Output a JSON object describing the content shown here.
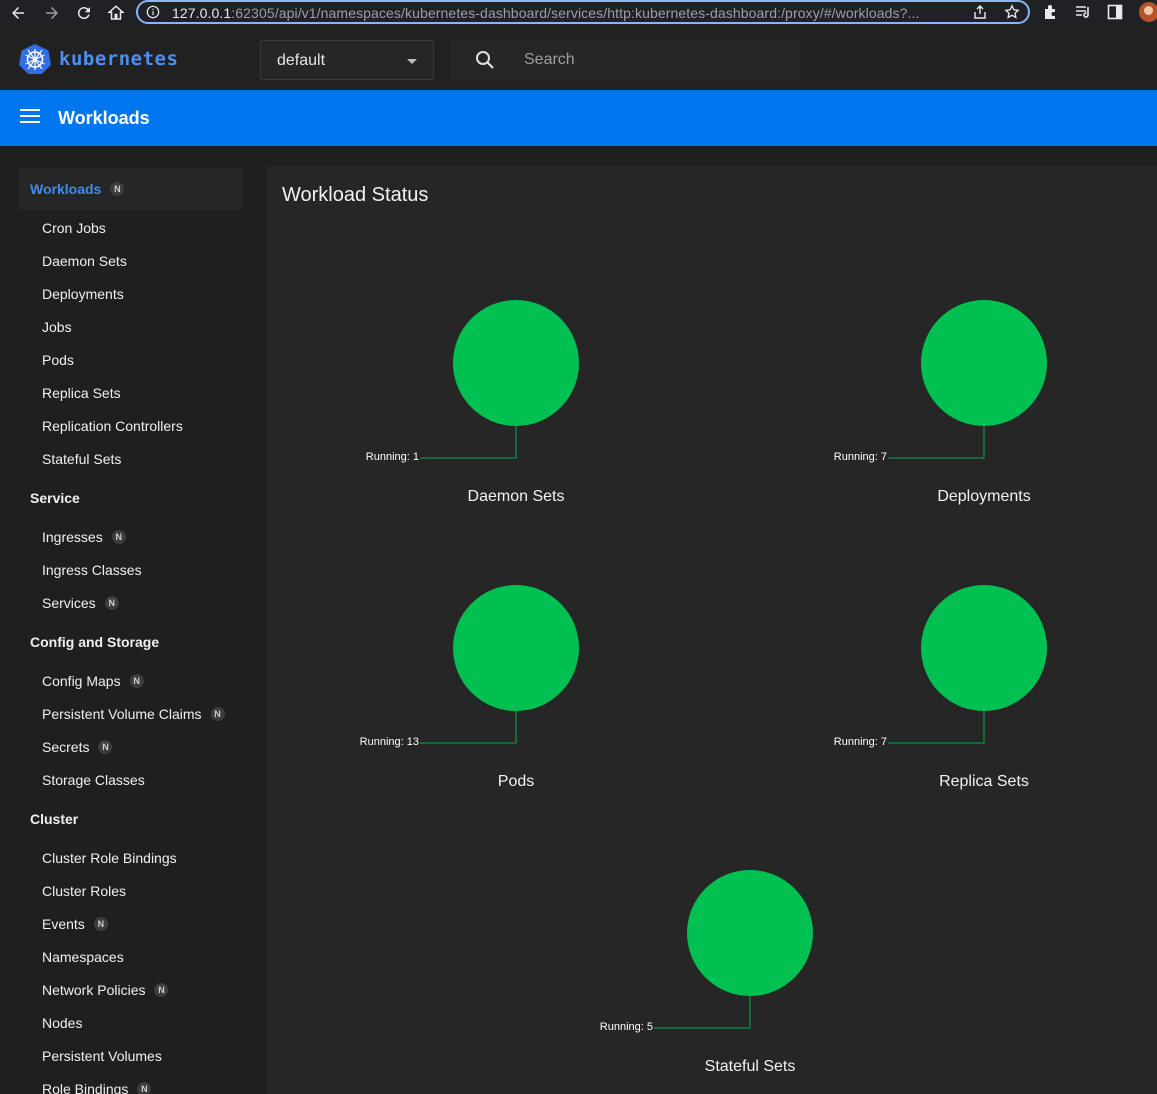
{
  "browser": {
    "url_host": "127.0.0.1",
    "url_rest": ":62305/api/v1/namespaces/kubernetes-dashboard/services/http:kubernetes-dashboard:/proxy/#/workloads?..."
  },
  "header": {
    "brand": "kubernetes",
    "namespace": "default",
    "search_placeholder": "Search",
    "page_title": "Workloads"
  },
  "sidebar": {
    "sections": [
      {
        "label": "Workloads",
        "badge": "N",
        "active": true,
        "items": [
          {
            "label": "Cron Jobs"
          },
          {
            "label": "Daemon Sets"
          },
          {
            "label": "Deployments"
          },
          {
            "label": "Jobs"
          },
          {
            "label": "Pods"
          },
          {
            "label": "Replica Sets"
          },
          {
            "label": "Replication Controllers"
          },
          {
            "label": "Stateful Sets"
          }
        ]
      },
      {
        "label": "Service",
        "items": [
          {
            "label": "Ingresses",
            "badge": "N"
          },
          {
            "label": "Ingress Classes"
          },
          {
            "label": "Services",
            "badge": "N"
          }
        ]
      },
      {
        "label": "Config and Storage",
        "items": [
          {
            "label": "Config Maps",
            "badge": "N"
          },
          {
            "label": "Persistent Volume Claims",
            "badge": "N"
          },
          {
            "label": "Secrets",
            "badge": "N"
          },
          {
            "label": "Storage Classes"
          }
        ]
      },
      {
        "label": "Cluster",
        "items": [
          {
            "label": "Cluster Role Bindings"
          },
          {
            "label": "Cluster Roles"
          },
          {
            "label": "Events",
            "badge": "N"
          },
          {
            "label": "Namespaces"
          },
          {
            "label": "Network Policies",
            "badge": "N"
          },
          {
            "label": "Nodes"
          },
          {
            "label": "Persistent Volumes"
          },
          {
            "label": "Role Bindings",
            "badge": "N"
          }
        ]
      }
    ]
  },
  "main": {
    "card_title": "Workload Status",
    "running_color": "#00c052",
    "charts": [
      {
        "name": "Daemon Sets",
        "running_label": "Running: 1",
        "running": 1
      },
      {
        "name": "Deployments",
        "running_label": "Running: 7",
        "running": 7
      },
      {
        "name": "Pods",
        "running_label": "Running: 13",
        "running": 13
      },
      {
        "name": "Replica Sets",
        "running_label": "Running: 7",
        "running": 7
      },
      {
        "name": "Stateful Sets",
        "running_label": "Running: 5",
        "running": 5
      }
    ]
  },
  "chart_data": [
    {
      "type": "pie",
      "title": "Daemon Sets",
      "slices": [
        {
          "label": "Running",
          "value": 1
        }
      ]
    },
    {
      "type": "pie",
      "title": "Deployments",
      "slices": [
        {
          "label": "Running",
          "value": 7
        }
      ]
    },
    {
      "type": "pie",
      "title": "Pods",
      "slices": [
        {
          "label": "Running",
          "value": 13
        }
      ]
    },
    {
      "type": "pie",
      "title": "Replica Sets",
      "slices": [
        {
          "label": "Running",
          "value": 7
        }
      ]
    },
    {
      "type": "pie",
      "title": "Stateful Sets",
      "slices": [
        {
          "label": "Running",
          "value": 5
        }
      ]
    }
  ]
}
